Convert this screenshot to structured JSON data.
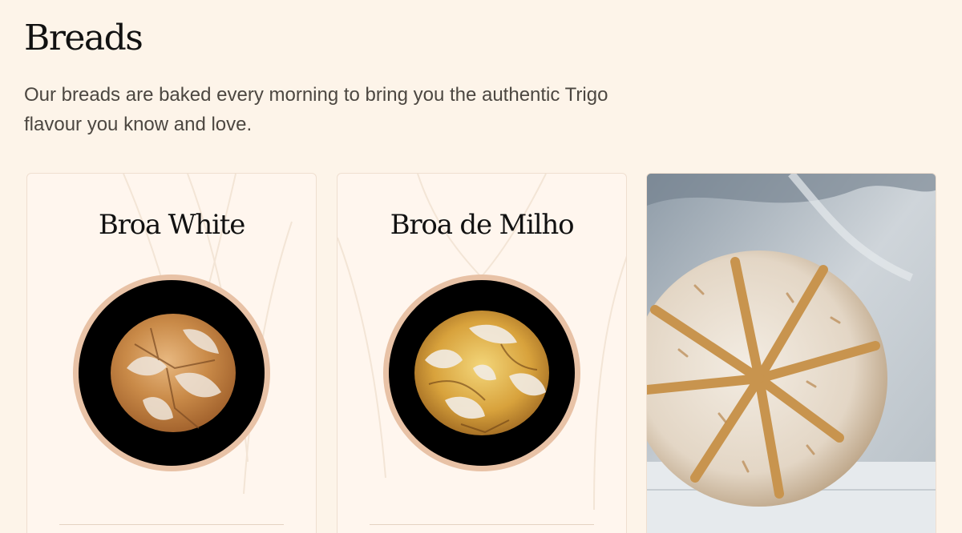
{
  "section": {
    "title": "Breads",
    "intro": "Our breads are baked every morning to bring you the authentic Trigo flavour you know and love."
  },
  "cards": [
    {
      "name": "Broa White",
      "image": "broa-white-bread"
    },
    {
      "name": "Broa de Milho",
      "image": "broa-de-milho-bread"
    },
    {
      "name": "",
      "image": "sourdough-loaf-photo"
    }
  ],
  "colors": {
    "background": "#fdf4e9",
    "card": "#fff6ee",
    "ring": "#e8c2a6",
    "text": "#111111",
    "muted": "#4c4741"
  }
}
